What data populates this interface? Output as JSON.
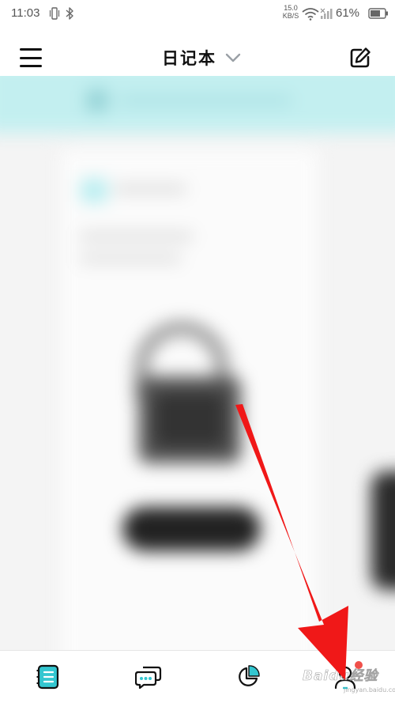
{
  "status_bar": {
    "time": "11:03",
    "net_speed_value": "15.0",
    "net_speed_unit": "KB/S",
    "battery_percent": "61%"
  },
  "header": {
    "title": "日记本"
  },
  "icons": {
    "menu": "menu-icon",
    "title_dropdown": "chevron-down-icon",
    "edit": "edit-icon",
    "nav": [
      "diary-icon",
      "chat-icon",
      "stats-icon",
      "profile-icon"
    ]
  },
  "colors": {
    "accent_teal": "#33c6d0",
    "banner_teal": "#c3eff0",
    "badge_red": "#f0504a",
    "arrow_red": "#f01818"
  },
  "watermark": {
    "text": "Baidu经验",
    "sub": "jingyan.baidu.com"
  }
}
